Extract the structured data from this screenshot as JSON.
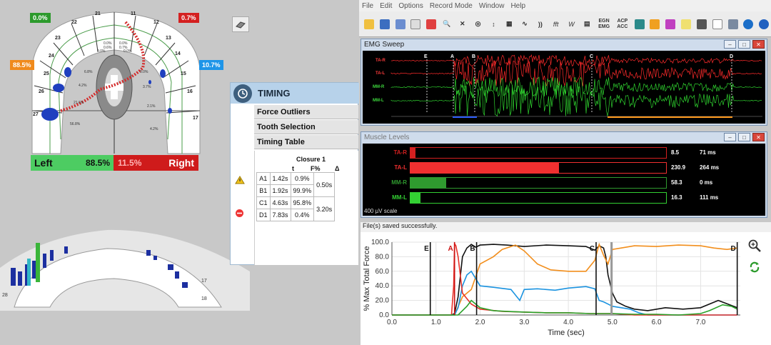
{
  "arch2d": {
    "top_left_pct": "0.0%",
    "top_right_pct": "0.7%",
    "side_left_pct": "88.5%",
    "side_right_pct": "10.7%",
    "balance": {
      "left_label": "Left",
      "left_pct": "88.5%",
      "right_pct": "11.5%",
      "right_label": "Right"
    },
    "tooth_numbers": {
      "t21": "21",
      "t11": "11",
      "t22": "22",
      "t12": "12",
      "t23": "23",
      "t13": "13",
      "t24": "24",
      "t14": "14",
      "t25": "25",
      "t15": "15",
      "t26": "26",
      "t16": "16",
      "t27": "27",
      "t17": "17"
    },
    "tooth_pcts": {
      "p1": "0.0%",
      "p2": "0.0%",
      "p3": "0.6%",
      "p4": "0.7%",
      "p5": "0.0%",
      "p6": "0.0%",
      "p7": "6.8%",
      "p8": "0.0%",
      "p9": "4.2%",
      "p10": "3.7%",
      "p11": "21.6%",
      "p12": "2.1%",
      "p13": "56.8%",
      "p14": "4.2%"
    }
  },
  "arch3d": {
    "n28": "28",
    "n17": "17",
    "n18": "18"
  },
  "timing": {
    "title": "TIMING",
    "sections": [
      "Force Outliers",
      "Tooth Selection",
      "Timing Table"
    ],
    "closure_label": "Closure 1",
    "col_t": "t",
    "col_f": "F%",
    "col_delta": "Δ",
    "rows": [
      {
        "id": "A1",
        "t": "1.42s",
        "f": "0.9%"
      },
      {
        "id": "B1",
        "t": "1.92s",
        "f": "99.9%"
      },
      {
        "id": "C1",
        "t": "4.63s",
        "f": "95.8%"
      },
      {
        "id": "D1",
        "t": "7.83s",
        "f": "0.4%"
      }
    ],
    "delta1": "0.50s",
    "delta2": "3.20s"
  },
  "menu": [
    "File",
    "Edit",
    "Options",
    "Record Mode",
    "Window",
    "Help"
  ],
  "toolbar": {
    "fft": "fft",
    "w": "W",
    "egn": "EGN",
    "emg": "EMG",
    "acp": "ACP",
    "acc": "ACC"
  },
  "emg_sweep": {
    "title": "EMG Sweep",
    "channels": [
      "TA-R",
      "TA-L",
      "MM-R",
      "MM-L"
    ],
    "markers": [
      "E",
      "A",
      "B",
      "C",
      "D"
    ]
  },
  "muscle_levels": {
    "title": "Muscle Levels",
    "scale": "400 µV scale",
    "rows": [
      {
        "name": "TA-R",
        "value": "8.5",
        "time": "71 ms",
        "level": 0.02,
        "color": "#d42020"
      },
      {
        "name": "TA-L",
        "value": "230.9",
        "time": "264 ms",
        "level": 0.58,
        "color": "#f03030"
      },
      {
        "name": "MM-R",
        "value": "58.3",
        "time": "0 ms",
        "level": 0.14,
        "color": "#2f9a2f"
      },
      {
        "name": "MM-L",
        "value": "16.3",
        "time": "111 ms",
        "level": 0.04,
        "color": "#33d033"
      }
    ]
  },
  "status_text": "File(s) saved successfully.",
  "chart_data": {
    "type": "line",
    "ylabel": "% Max Total Force",
    "xlabel": "Time (sec)",
    "xlim": [
      0,
      7.9
    ],
    "ylim": [
      0,
      100
    ],
    "x_ticks": [
      "0.0",
      "1.0",
      "2.0",
      "3.0",
      "4.0",
      "5.0",
      "6.0",
      "7.0"
    ],
    "y_ticks": [
      "0.0",
      "20.0",
      "40.0",
      "60.0",
      "80.0",
      "100.0"
    ],
    "markers": [
      {
        "label": "E",
        "x": 0.87,
        "color": "#111111"
      },
      {
        "label": "A",
        "x": 1.42,
        "color": "#cc1111"
      },
      {
        "label": "B",
        "x": 1.92,
        "color": "#111111"
      },
      {
        "label": "C",
        "x": 4.63,
        "color": "#111111"
      },
      {
        "label": "",
        "x": 4.98,
        "color": "#999999"
      },
      {
        "label": "D",
        "x": 7.83,
        "color": "#111111"
      }
    ],
    "series": [
      {
        "color": "#111111",
        "x": [
          0,
          1.35,
          1.42,
          1.5,
          1.6,
          1.7,
          1.8,
          1.9,
          2.0,
          2.3,
          2.6,
          3.0,
          3.5,
          4.0,
          4.4,
          4.6,
          4.7,
          4.8,
          4.85,
          4.9,
          5.0,
          5.1,
          5.3,
          5.5,
          5.8,
          6.2,
          6.6,
          7.0,
          7.4,
          7.83
        ],
        "y": [
          0,
          0,
          2,
          25,
          80,
          92,
          97,
          93,
          96,
          97,
          96,
          94,
          96,
          95,
          94,
          89,
          95,
          92,
          80,
          55,
          30,
          18,
          12,
          8,
          6,
          10,
          8,
          10,
          20,
          10
        ]
      },
      {
        "color": "#f28e1c",
        "x": [
          0,
          1.42,
          1.6,
          1.8,
          2.0,
          2.3,
          2.5,
          2.8,
          3.0,
          3.3,
          3.6,
          4.0,
          4.4,
          4.6,
          4.7,
          4.8,
          4.9,
          5.0,
          5.2,
          5.5,
          6.0,
          6.5,
          7.0,
          7.3,
          7.6,
          7.83
        ],
        "y": [
          0,
          0,
          25,
          35,
          70,
          80,
          90,
          96,
          88,
          70,
          62,
          60,
          60,
          75,
          97,
          82,
          70,
          90,
          92,
          95,
          94,
          96,
          95,
          92,
          90,
          92
        ]
      },
      {
        "color": "#1b93e0",
        "x": [
          0,
          1.42,
          1.5,
          1.6,
          1.7,
          1.8,
          2.0,
          2.3,
          2.7,
          2.9,
          3.0,
          3.3,
          3.7,
          4.0,
          4.4,
          4.6,
          4.7,
          4.8,
          4.9,
          5.0,
          5.2,
          5.4,
          5.6,
          5.8,
          6.0,
          7.83
        ],
        "y": [
          0,
          0,
          10,
          40,
          55,
          60,
          40,
          38,
          35,
          20,
          35,
          36,
          34,
          37,
          39,
          36,
          20,
          18,
          15,
          12,
          10,
          8,
          3,
          0,
          0,
          0
        ]
      },
      {
        "color": "#e8322a",
        "x": [
          0,
          1.35,
          1.4,
          1.42,
          1.45,
          1.5,
          1.6,
          1.8,
          2.0,
          2.5,
          3.0,
          3.5,
          4.0,
          4.5,
          5.0,
          5.5,
          7.83
        ],
        "y": [
          0,
          0,
          40,
          98,
          95,
          80,
          30,
          15,
          8,
          5,
          4,
          3,
          3,
          2,
          2,
          0,
          0
        ]
      },
      {
        "color": "#2aa22a",
        "x": [
          0,
          1.5,
          1.7,
          1.8,
          2.0,
          2.3,
          2.6,
          3.0,
          3.5,
          4.0,
          4.5,
          5.0,
          5.5,
          6.0,
          6.5,
          7.0,
          7.2,
          7.5,
          7.7,
          7.83
        ],
        "y": [
          0,
          0,
          12,
          20,
          10,
          6,
          5,
          4,
          3,
          3,
          2,
          2,
          1,
          1,
          0,
          2,
          6,
          14,
          12,
          8
        ]
      }
    ]
  }
}
